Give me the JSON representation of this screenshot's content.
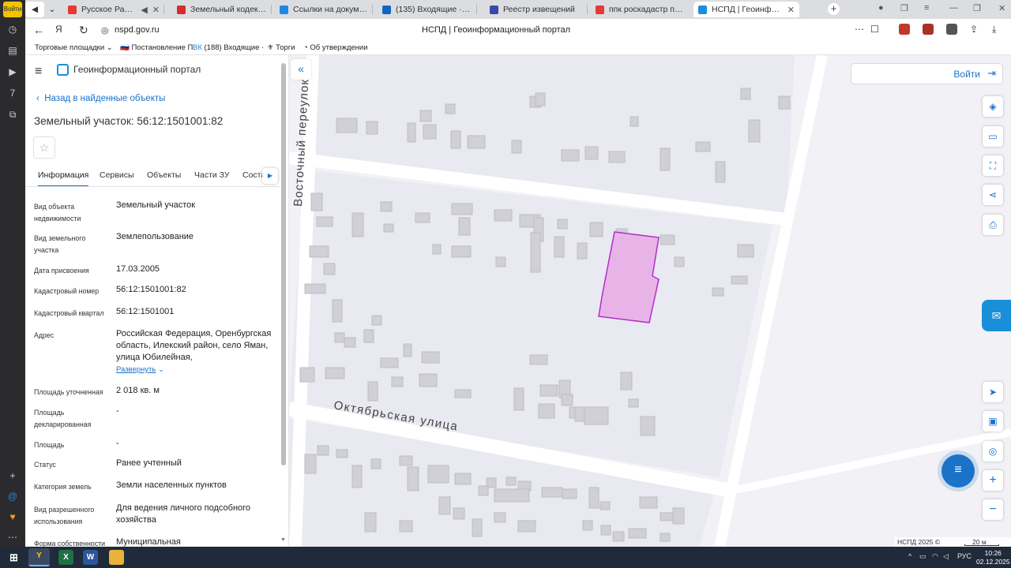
{
  "browser": {
    "rail_items": [
      "Войти"
    ],
    "tabs": [
      {
        "label": "Русское Радио — сл",
        "color": "#e53935",
        "active": false
      },
      {
        "label": "Земельный кодекс Росси",
        "color": "#d32f2f",
        "active": false
      },
      {
        "label": "Ссылки на документ / фр",
        "color": "#1e88e5",
        "active": false
      },
      {
        "label": "(135) Входящие · Почта М",
        "color": "#1565c0",
        "active": false
      },
      {
        "label": "Реестр извещений",
        "color": "#3949ab",
        "active": false
      },
      {
        "label": "ппк роскадастр по оренб",
        "color": "#e53935",
        "active": false
      },
      {
        "label": "НСПД | Геоинформацио",
        "color": "#1a8fd9",
        "active": true
      }
    ],
    "url": "nspd.gov.ru",
    "page_title": "НСПД | Геоинформационный портал",
    "bookmarks": [
      "Торговые площадки",
      "Постановление П",
      "(188) Входящие ·",
      "Торги",
      "Об утверждении"
    ]
  },
  "panel": {
    "portal_name": "Геоинформационный портал",
    "back_link": "Назад в найденные объекты",
    "title": "Земельный участок: 56:12:1501001:82",
    "tabs": [
      "Информация",
      "Сервисы",
      "Объекты",
      "Части ЗУ",
      "Соста"
    ],
    "fields": [
      {
        "label": "Вид объекта недвижимости",
        "value": "Земельный участок"
      },
      {
        "label": "Вид земельного участка",
        "value": "Землепользование"
      },
      {
        "label": "Дата присвоения",
        "value": "17.03.2005"
      },
      {
        "label": "Кадастровый номер",
        "value": "56:12:1501001:82"
      },
      {
        "label": "Кадастровый квартал",
        "value": "56:12:1501001"
      },
      {
        "label": "Адрес",
        "value": "Российская Федерация, Оренбургская область, Илекский район, село Яман, улица Юбилейная,"
      },
      {
        "label": "Площадь уточненная",
        "value": "2 018 кв. м"
      },
      {
        "label": "Площадь декларированная",
        "value": "-"
      },
      {
        "label": "Площадь",
        "value": "-"
      },
      {
        "label": "Статус",
        "value": "Ранее учтенный"
      },
      {
        "label": "Категория земель",
        "value": "Земли населенных пунктов"
      },
      {
        "label": "Вид разрешенного использования",
        "value": "Для ведения личного подсобного хозяйства"
      },
      {
        "label": "Форма собственности",
        "value": "Муниципальная"
      }
    ],
    "expand_label": "Развернуть"
  },
  "map": {
    "streets": {
      "vertical": "Восточный переулок",
      "horizontal": "Октябрьская улица"
    },
    "login_label": "Войти",
    "attribution": "НСПД 2025 ©",
    "scale": "20 м",
    "parcel_fill": "#e8b4e8",
    "parcel_stroke": "#b12ec9"
  },
  "taskbar": {
    "lang": "РУС",
    "time": "10:26",
    "date": "02.12.2025"
  }
}
